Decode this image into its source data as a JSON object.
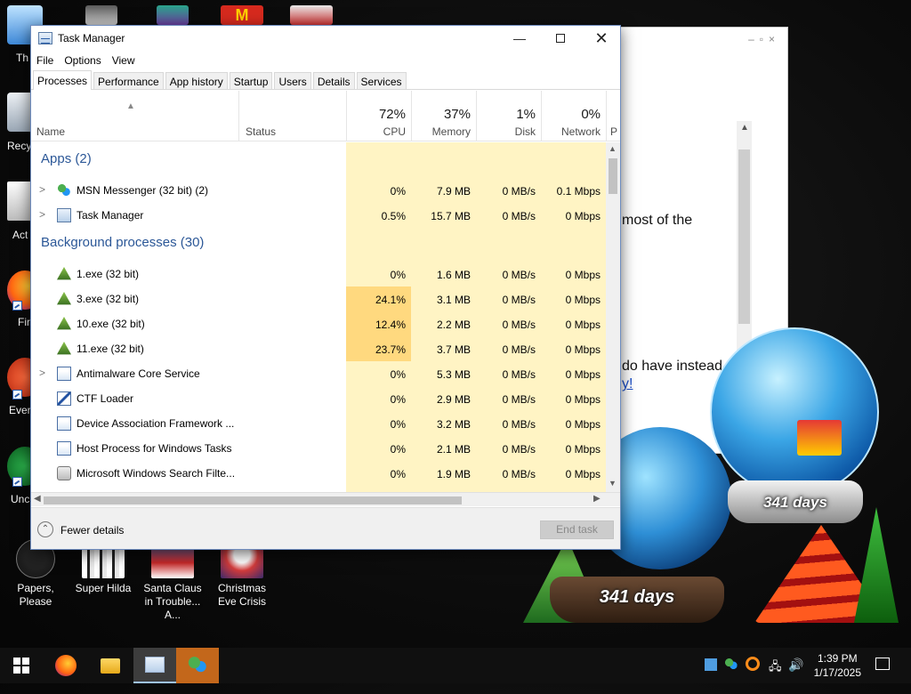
{
  "desktop": {
    "left_icons": [
      {
        "label": "Th"
      },
      {
        "label": "Recy"
      },
      {
        "label": "Act"
      },
      {
        "label": "Fir"
      },
      {
        "label": "Ever"
      },
      {
        "label": "Unc"
      }
    ],
    "bottom_icons": [
      {
        "label": "Papers, Please",
        "icon": "papers-please-icon"
      },
      {
        "label": "Super Hilda",
        "icon": "super-hilda-icon"
      },
      {
        "label": "Santa Claus in Trouble... A...",
        "icon": "santa-claus-icon"
      },
      {
        "label": "Christmas Eve Crisis",
        "icon": "christmas-eve-crisis-icon"
      }
    ],
    "background_window": {
      "line1": "most of the",
      "line2": "do have instead",
      "link": "y!"
    },
    "countdowns": {
      "globe_right": "341 days",
      "globe_left": "341 days"
    }
  },
  "task_manager": {
    "title": "Task Manager",
    "menu": [
      "File",
      "Options",
      "View"
    ],
    "tabs": [
      "Processes",
      "Performance",
      "App history",
      "Startup",
      "Users",
      "Details",
      "Services"
    ],
    "active_tab": "Processes",
    "columns": {
      "name": "Name",
      "status": "Status",
      "cpu": {
        "pct": "72%",
        "label": "CPU"
      },
      "memory": {
        "pct": "37%",
        "label": "Memory"
      },
      "disk": {
        "pct": "1%",
        "label": "Disk"
      },
      "network": {
        "pct": "0%",
        "label": "Network"
      },
      "power_partial": "P"
    },
    "groups": {
      "apps": "Apps (2)",
      "background": "Background processes (30)"
    },
    "apps": [
      {
        "name": "MSN Messenger (32 bit) (2)",
        "cpu": "0%",
        "memory": "7.9 MB",
        "disk": "0 MB/s",
        "network": "0.1 Mbps",
        "icon": "msn-messenger-icon"
      },
      {
        "name": "Task Manager",
        "cpu": "0.5%",
        "memory": "15.7 MB",
        "disk": "0 MB/s",
        "network": "0 Mbps",
        "icon": "task-manager-icon"
      }
    ],
    "background": [
      {
        "name": "1.exe (32 bit)",
        "cpu": "0%",
        "memory": "1.6 MB",
        "disk": "0 MB/s",
        "network": "0 Mbps",
        "icon": "tree-icon"
      },
      {
        "name": "3.exe (32 bit)",
        "cpu": "24.1%",
        "memory": "3.1 MB",
        "disk": "0 MB/s",
        "network": "0 Mbps",
        "icon": "tree-icon"
      },
      {
        "name": "10.exe (32 bit)",
        "cpu": "12.4%",
        "memory": "2.2 MB",
        "disk": "0 MB/s",
        "network": "0 Mbps",
        "icon": "tree-icon"
      },
      {
        "name": "11.exe (32 bit)",
        "cpu": "23.7%",
        "memory": "3.7 MB",
        "disk": "0 MB/s",
        "network": "0 Mbps",
        "icon": "tree-icon"
      },
      {
        "name": "Antimalware Core Service",
        "cpu": "0%",
        "memory": "5.3 MB",
        "disk": "0 MB/s",
        "network": "0 Mbps",
        "icon": "service-window-icon"
      },
      {
        "name": "CTF Loader",
        "cpu": "0%",
        "memory": "2.9 MB",
        "disk": "0 MB/s",
        "network": "0 Mbps",
        "icon": "ctf-loader-icon"
      },
      {
        "name": "Device Association Framework ...",
        "cpu": "0%",
        "memory": "3.2 MB",
        "disk": "0 MB/s",
        "network": "0 Mbps",
        "icon": "service-window-icon"
      },
      {
        "name": "Host Process for Windows Tasks",
        "cpu": "0%",
        "memory": "2.1 MB",
        "disk": "0 MB/s",
        "network": "0 Mbps",
        "icon": "service-window-icon"
      },
      {
        "name": "Microsoft Windows Search Filte...",
        "cpu": "0%",
        "memory": "1.9 MB",
        "disk": "0 MB/s",
        "network": "0 Mbps",
        "icon": "search-filter-icon"
      }
    ],
    "footer": {
      "fewer_details": "Fewer details",
      "end_task": "End task"
    }
  },
  "taskbar": {
    "clock_time": "1:39 PM",
    "clock_date": "1/17/2025"
  },
  "colors": {
    "cpu_high": "#ffd97f",
    "cpu_light": "#fff4c4",
    "group_blue": "#2b5797",
    "taskbar": "#101010"
  }
}
